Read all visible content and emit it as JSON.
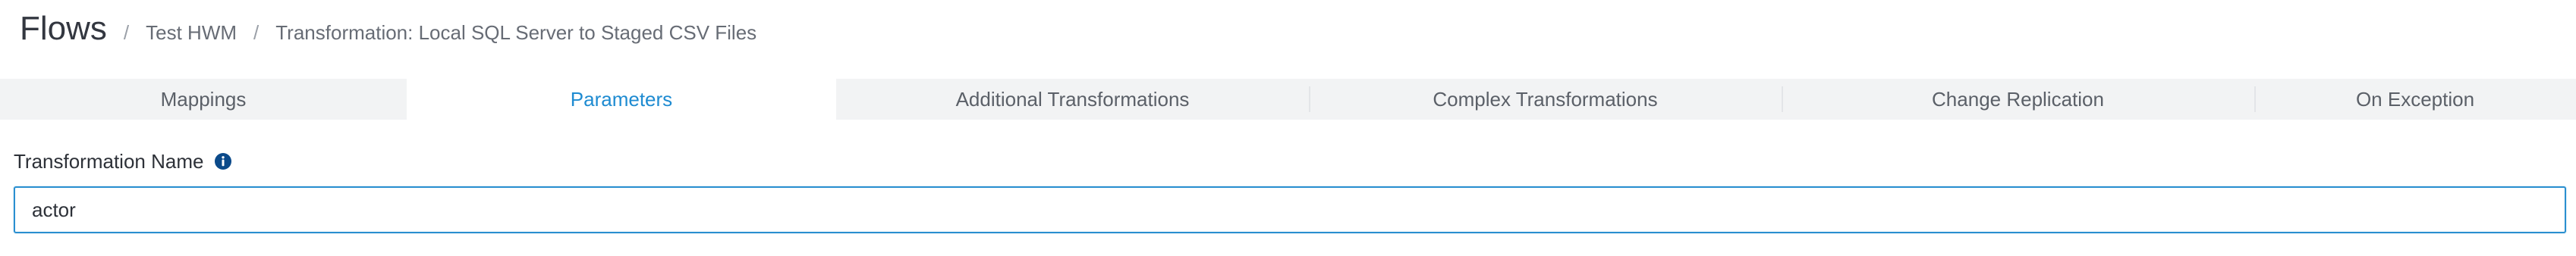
{
  "breadcrumb": {
    "title": "Flows",
    "separator": "/",
    "items": [
      "Test HWM",
      "Transformation: Local SQL Server to Staged CSV Files"
    ]
  },
  "tabs": [
    {
      "label": "Mappings",
      "active": false
    },
    {
      "label": "Parameters",
      "active": true
    },
    {
      "label": "Additional Transformations",
      "active": false
    },
    {
      "label": "Complex Transformations",
      "active": false
    },
    {
      "label": "Change Replication",
      "active": false
    },
    {
      "label": "On Exception",
      "active": false
    }
  ],
  "form": {
    "transformation_name_label": "Transformation Name",
    "transformation_name_value": "actor",
    "info_icon": "info-icon"
  },
  "colors": {
    "accent": "#1e8bd1",
    "tab_bg": "#f2f3f4",
    "info_icon": "#0b4a8a"
  }
}
